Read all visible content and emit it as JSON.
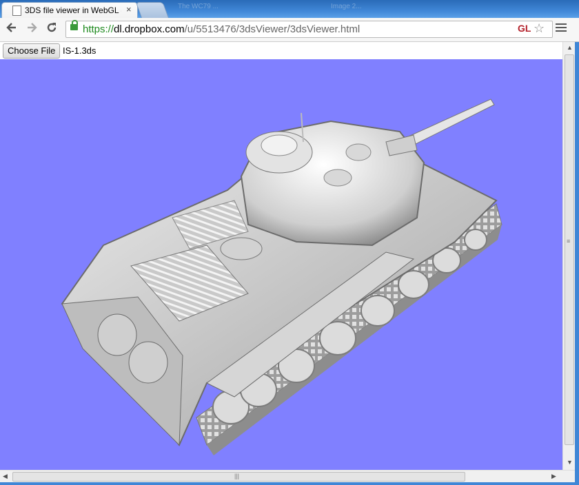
{
  "browser": {
    "active_tab_title": "3DS file viewer in WebGL - ",
    "tab_close": "×",
    "background_titles": [
      "The WC79 ...",
      "Image 2..."
    ]
  },
  "address": {
    "scheme": "https://",
    "host": "dl.dropbox.com",
    "path": "/u/5513476/3dsViewer/3dsViewer.html"
  },
  "extension": {
    "gl_badge": "GL"
  },
  "file_input": {
    "button_label": "Choose File",
    "file_name": "IS-1.3ds"
  },
  "viewport": {
    "background_color": "#8080ff",
    "model_icon": "tank-3d-model"
  },
  "icons": {
    "back": "back-icon",
    "forward": "forward-icon",
    "reload": "reload-icon",
    "lock": "lock-icon",
    "bookmark": "star-icon",
    "menu": "menu-icon"
  }
}
